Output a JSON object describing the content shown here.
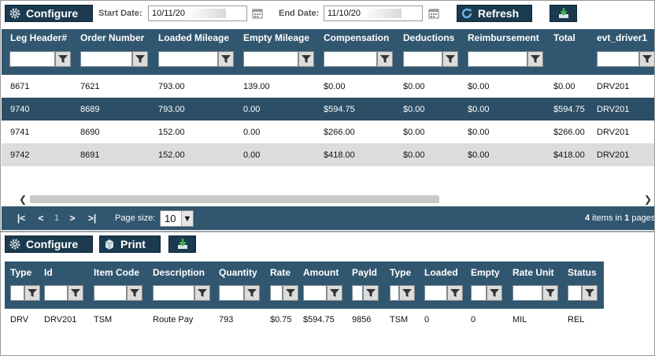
{
  "toolbar": {
    "configure_label": "Configure",
    "start_date_label": "Start Date:",
    "start_date_value": "10/11/20",
    "end_date_label": "End Date:",
    "end_date_value": "11/10/20",
    "refresh_label": "Refresh",
    "icons": {
      "configure": "gear-icon",
      "calendar": "calendar-icon",
      "refresh": "refresh-icon",
      "export": "export-icon"
    }
  },
  "top_grid": {
    "columns": [
      "Leg Header#",
      "Order Number",
      "Loaded Mileage",
      "Empty Mileage",
      "Compensation",
      "Deductions",
      "Reimbursement",
      "Total",
      "evt_driver1"
    ],
    "rows": [
      [
        "8671",
        "7621",
        "793.00",
        "139.00",
        "$0.00",
        "$0.00",
        "$0.00",
        "$0.00",
        "DRV201"
      ],
      [
        "9740",
        "8689",
        "793.00",
        "0.00",
        "$594.75",
        "$0.00",
        "$0.00",
        "$594.75",
        "DRV201"
      ],
      [
        "9741",
        "8690",
        "152.00",
        "0.00",
        "$266.00",
        "$0.00",
        "$0.00",
        "$266.00",
        "DRV201"
      ],
      [
        "9742",
        "8691",
        "152.00",
        "0.00",
        "$418.00",
        "$0.00",
        "$0.00",
        "$418.00",
        "DRV201"
      ]
    ],
    "row_styles": [
      "white",
      "dark",
      "white",
      "gray"
    ]
  },
  "pager": {
    "first": "|<",
    "prev": "<",
    "page": "1",
    "next": ">",
    "last": ">|",
    "page_size_label": "Page size:",
    "page_size_value": "10",
    "items_count": "4",
    "items_mid": " items in ",
    "pages_count": "1",
    "pages_suffix": " pages"
  },
  "second_toolbar": {
    "configure_label": "Configure",
    "print_label": "Print",
    "icons": {
      "configure": "gear-icon",
      "print": "print-icon",
      "export": "export-icon"
    }
  },
  "bottom_grid": {
    "columns": [
      "Type",
      "Id",
      "Item Code",
      "Description",
      "Quantity",
      "Rate",
      "Amount",
      "PayId",
      "Type",
      "Loaded",
      "Empty",
      "Rate Unit",
      "Status"
    ],
    "rows": [
      [
        "DRV",
        "DRV201",
        "TSM",
        "Route Pay",
        "793",
        "$0.75",
        "$594.75",
        "9856",
        "TSM",
        "0",
        "0",
        "MIL",
        "REL"
      ]
    ]
  },
  "colors": {
    "header_bg": "#31566f",
    "selected_row": "#2c4e66",
    "alt_row": "#dcdcdc",
    "button_bg": "#1b3a4f"
  }
}
